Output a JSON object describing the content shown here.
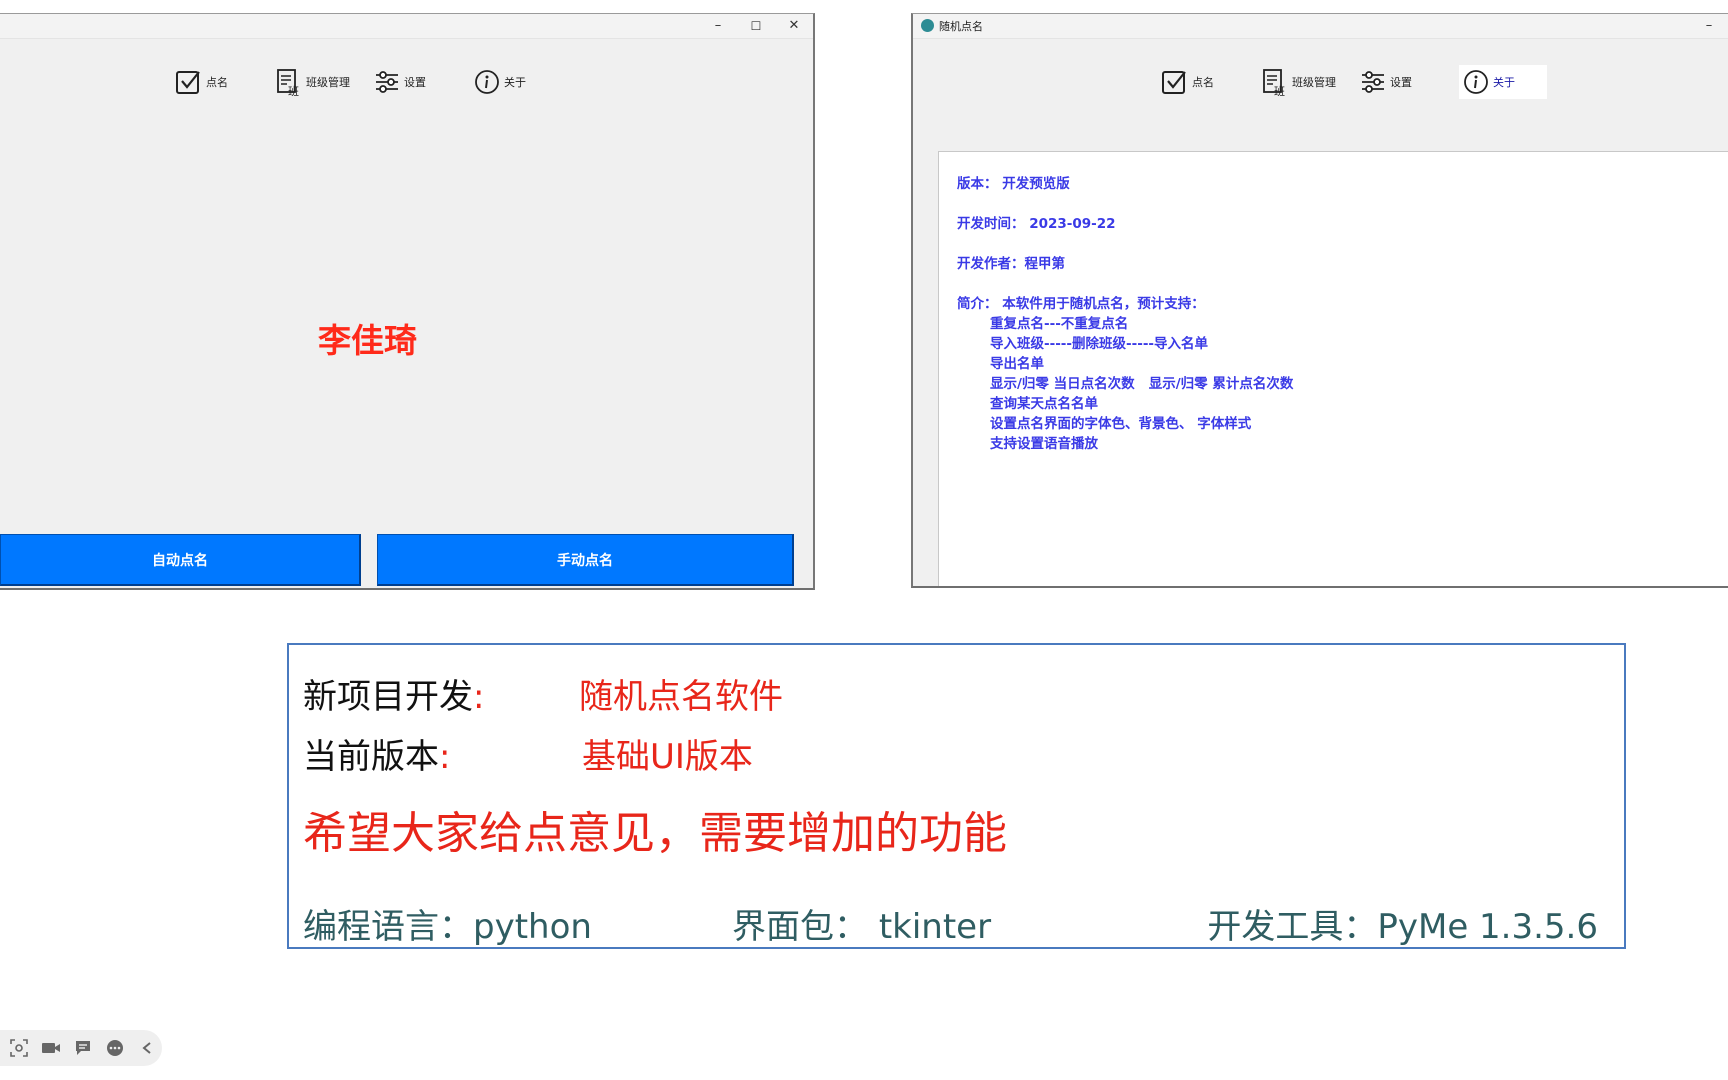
{
  "left_window": {
    "controls": [
      "–",
      "☐",
      "✕"
    ],
    "toolbar": [
      {
        "label": "点名",
        "icon": "checkbox-icon"
      },
      {
        "label": "班级管理",
        "icon": "class-list-icon"
      },
      {
        "label": "设置",
        "icon": "sliders-icon"
      },
      {
        "label": "关于",
        "icon": "info-icon"
      }
    ],
    "called_name": "李佳琦",
    "auto_button": "自动点名",
    "manual_button": "手动点名",
    "name_color": "#ff2a1a",
    "button_color": "#0078ff"
  },
  "right_window": {
    "title": "随机点名",
    "controls": [
      "–"
    ],
    "toolbar": [
      {
        "label": "点名",
        "icon": "checkbox-icon"
      },
      {
        "label": "班级管理",
        "icon": "class-list-icon"
      },
      {
        "label": "设置",
        "icon": "sliders-icon"
      },
      {
        "label": "关于",
        "icon": "info-icon",
        "active": true
      }
    ],
    "about": {
      "version_label": "版本：",
      "version": "开发预览版",
      "date_label": "开发时间：",
      "date": "2023-09-22",
      "author_label": "开发作者：",
      "author": "程甲第",
      "intro_label": "简介：",
      "intro": "本软件用于随机点名，预计支持：",
      "features": [
        "重复点名---不重复点名",
        "导入班级-----删除班级-----导入名单",
        "导出名单",
        "显示/归零 当日点名次数   显示/归零 累计点名次数",
        "查询某天点名名单",
        "设置点名界面的字体色、背景色、 字体样式",
        "支持设置语音播放"
      ],
      "text_color": "#3a3ae6"
    }
  },
  "info_box": {
    "project_label": "新项目开发",
    "project_colon": ":",
    "project_value": "随机点名软件",
    "version_label": "当前版本",
    "version_colon": ":",
    "version_value": "基础UI版本",
    "request": "希望大家给点意见，需要增加的功能",
    "lang_label": "编程语言：",
    "lang_value": "python",
    "ui_label": "界面包：",
    "ui_value": "tkinter",
    "tool_label": "开发工具：",
    "tool_value": "PyMe 1.3.5.6",
    "accent_color": "#e8261a",
    "footer_color": "#2f5d62"
  },
  "taskbar_icons": [
    "screenshot-icon",
    "camera-icon",
    "chat-icon",
    "more-icon",
    "collapse-icon"
  ]
}
